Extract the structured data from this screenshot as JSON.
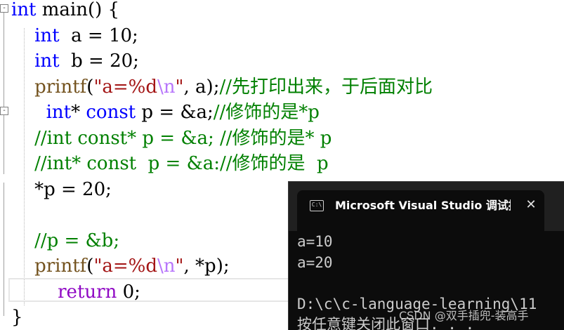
{
  "editor": {
    "lines": [
      {
        "parts": [
          [
            "int",
            "kw"
          ],
          [
            " main() {",
            ""
          ]
        ]
      },
      {
        "parts": [
          [
            "    ",
            ""
          ],
          [
            "int",
            "kw"
          ],
          [
            "  a = ",
            ""
          ],
          [
            "10",
            "num"
          ],
          [
            ";",
            ""
          ]
        ]
      },
      {
        "parts": [
          [
            "    ",
            ""
          ],
          [
            "int",
            "kw"
          ],
          [
            "  b = ",
            ""
          ],
          [
            "20",
            "num"
          ],
          [
            ";",
            ""
          ]
        ]
      },
      {
        "parts": [
          [
            "    ",
            ""
          ],
          [
            "printf",
            "fn"
          ],
          [
            "(",
            ""
          ],
          [
            "\"a=%d",
            "str"
          ],
          [
            "\\n",
            "esc"
          ],
          [
            "\"",
            "str"
          ],
          [
            ", a);",
            ""
          ],
          [
            "//先打印出来，于后面对比",
            "cm"
          ]
        ]
      },
      {
        "parts": [
          [
            "      ",
            ""
          ],
          [
            "int",
            "kw"
          ],
          [
            "* ",
            ""
          ],
          [
            "const",
            "kw"
          ],
          [
            " p = &a;",
            ""
          ],
          [
            "//修饰的是*p",
            "cm"
          ]
        ]
      },
      {
        "parts": [
          [
            "    ",
            ""
          ],
          [
            "//int const* p = &a; //修饰的是* p",
            "cm"
          ]
        ]
      },
      {
        "parts": [
          [
            "    ",
            ""
          ],
          [
            "//int* const  p = &a://修饰的是  p",
            "cm"
          ]
        ]
      },
      {
        "parts": [
          [
            "    ",
            ""
          ],
          [
            "*p = ",
            ""
          ],
          [
            "20",
            "num"
          ],
          [
            ";",
            ""
          ]
        ]
      },
      {
        "parts": [
          [
            "",
            ""
          ]
        ]
      },
      {
        "parts": [
          [
            "    ",
            ""
          ],
          [
            "//p = &b;",
            "cm"
          ]
        ]
      },
      {
        "parts": [
          [
            "    ",
            ""
          ],
          [
            "printf",
            "fn"
          ],
          [
            "(",
            ""
          ],
          [
            "\"a=%d",
            "str"
          ],
          [
            "\\n",
            "esc"
          ],
          [
            "\"",
            "str"
          ],
          [
            ", *p);",
            ""
          ]
        ]
      },
      {
        "parts": [
          [
            "        ",
            ""
          ],
          [
            "return",
            "kwp"
          ],
          [
            " ",
            ""
          ],
          [
            "0",
            "num"
          ],
          [
            ";",
            ""
          ]
        ]
      },
      {
        "parts": [
          [
            "}",
            ""
          ]
        ]
      }
    ],
    "fold_markers": [
      "-",
      "-"
    ]
  },
  "console": {
    "title": "Microsoft Visual Studio 调试控制台",
    "icon": "cmd-icon",
    "icon_text": "C:\\",
    "close_symbol": "✕",
    "output": [
      "a=10",
      "a=20",
      "",
      "D:\\c\\c-language-learning\\11",
      "按任意键关闭此窗口. . ."
    ]
  },
  "watermark": "CSDN @双手插兜-装高手"
}
